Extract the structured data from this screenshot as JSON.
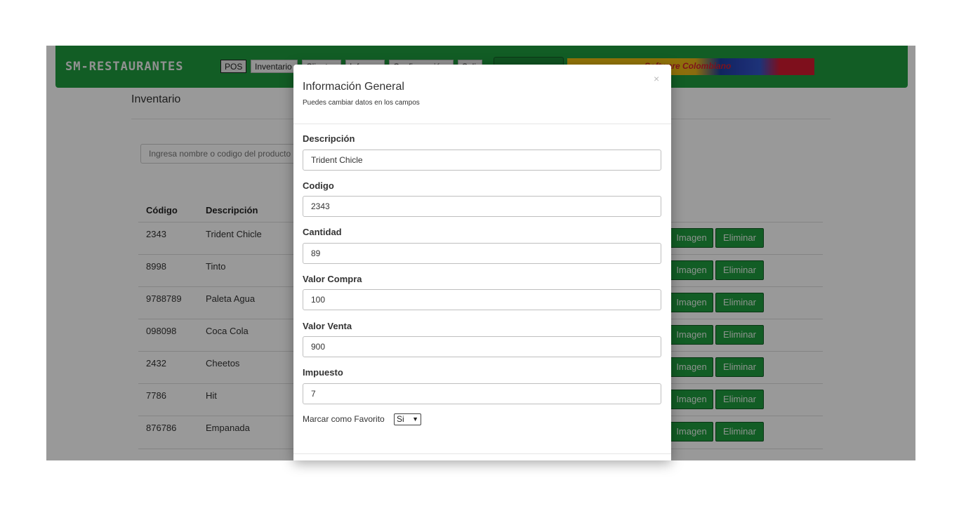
{
  "brand": "SM-RESTAURANTES",
  "nav": [
    "POS",
    "Inventario",
    "Clientes",
    "Informes",
    "Configuración",
    "Salir"
  ],
  "banner_text": "Software Colombiano",
  "page_title": "Inventario",
  "search": {
    "placeholder": "Ingresa nombre o codigo del producto"
  },
  "table": {
    "headers": [
      "Código",
      "Descripción"
    ],
    "rows": [
      {
        "code": "2343",
        "desc": "Trident Chicle"
      },
      {
        "code": "8998",
        "desc": "Tinto"
      },
      {
        "code": "9788789",
        "desc": "Paleta Agua"
      },
      {
        "code": "098098",
        "desc": "Coca Cola"
      },
      {
        "code": "2432",
        "desc": "Cheetos"
      },
      {
        "code": "7786",
        "desc": "Hit"
      },
      {
        "code": "876786",
        "desc": "Empanada"
      }
    ],
    "image_label": "Imagen",
    "delete_label": "Eliminar"
  },
  "modal": {
    "title": "Información General",
    "subtitle": "Puedes cambiar datos en los campos",
    "close": "×",
    "fields": {
      "descripcion": {
        "label": "Descripción",
        "value": "Trident Chicle"
      },
      "codigo": {
        "label": "Codigo",
        "value": "2343"
      },
      "cantidad": {
        "label": "Cantidad",
        "value": "89"
      },
      "valor_compra": {
        "label": "Valor Compra",
        "value": "100"
      },
      "valor_venta": {
        "label": "Valor Venta",
        "value": "900"
      },
      "impuesto": {
        "label": "Impuesto",
        "value": "7"
      }
    },
    "favorite": {
      "label": "Marcar como Favorito",
      "value": "Si"
    }
  },
  "colors": {
    "brand_green": "#1e9b3e",
    "overlay": "rgba(0,0,0,0.40)"
  }
}
